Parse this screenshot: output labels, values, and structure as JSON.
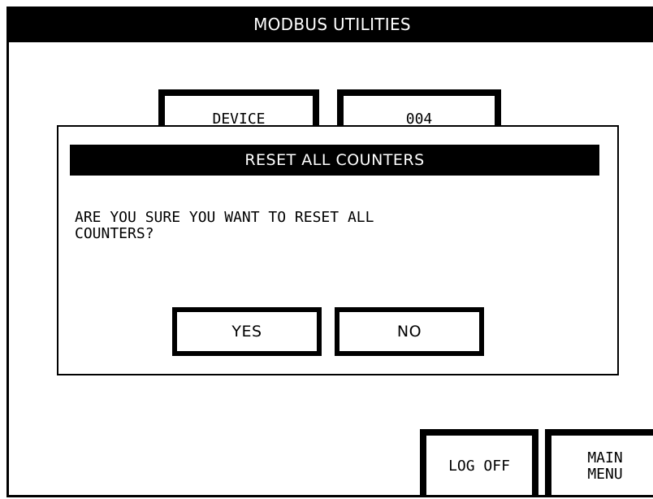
{
  "header": {
    "title": "MODBUS UTILITIES"
  },
  "background": {
    "device_label": "DEVICE",
    "device_value": "004"
  },
  "dialog": {
    "title": "RESET ALL COUNTERS",
    "message": "ARE YOU SURE YOU WANT TO RESET ALL\nCOUNTERS?",
    "yes_label": "YES",
    "no_label": "NO"
  },
  "footer": {
    "log_off_label": "LOG OFF",
    "main_menu_label": "MAIN\nMENU"
  }
}
